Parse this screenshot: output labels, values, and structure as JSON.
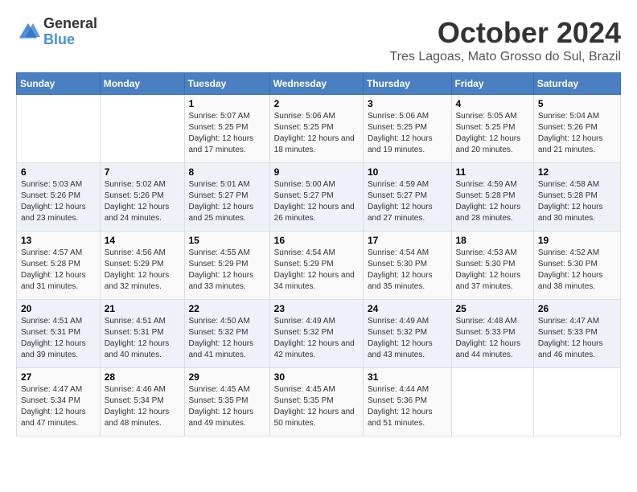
{
  "logo": {
    "general": "General",
    "blue": "Blue"
  },
  "header": {
    "month": "October 2024",
    "location": "Tres Lagoas, Mato Grosso do Sul, Brazil"
  },
  "weekdays": [
    "Sunday",
    "Monday",
    "Tuesday",
    "Wednesday",
    "Thursday",
    "Friday",
    "Saturday"
  ],
  "weeks": [
    [
      {
        "day": "",
        "sunrise": "",
        "sunset": "",
        "daylight": ""
      },
      {
        "day": "",
        "sunrise": "",
        "sunset": "",
        "daylight": ""
      },
      {
        "day": "1",
        "sunrise": "Sunrise: 5:07 AM",
        "sunset": "Sunset: 5:25 PM",
        "daylight": "Daylight: 12 hours and 17 minutes."
      },
      {
        "day": "2",
        "sunrise": "Sunrise: 5:06 AM",
        "sunset": "Sunset: 5:25 PM",
        "daylight": "Daylight: 12 hours and 18 minutes."
      },
      {
        "day": "3",
        "sunrise": "Sunrise: 5:06 AM",
        "sunset": "Sunset: 5:25 PM",
        "daylight": "Daylight: 12 hours and 19 minutes."
      },
      {
        "day": "4",
        "sunrise": "Sunrise: 5:05 AM",
        "sunset": "Sunset: 5:25 PM",
        "daylight": "Daylight: 12 hours and 20 minutes."
      },
      {
        "day": "5",
        "sunrise": "Sunrise: 5:04 AM",
        "sunset": "Sunset: 5:26 PM",
        "daylight": "Daylight: 12 hours and 21 minutes."
      }
    ],
    [
      {
        "day": "6",
        "sunrise": "Sunrise: 5:03 AM",
        "sunset": "Sunset: 5:26 PM",
        "daylight": "Daylight: 12 hours and 23 minutes."
      },
      {
        "day": "7",
        "sunrise": "Sunrise: 5:02 AM",
        "sunset": "Sunset: 5:26 PM",
        "daylight": "Daylight: 12 hours and 24 minutes."
      },
      {
        "day": "8",
        "sunrise": "Sunrise: 5:01 AM",
        "sunset": "Sunset: 5:27 PM",
        "daylight": "Daylight: 12 hours and 25 minutes."
      },
      {
        "day": "9",
        "sunrise": "Sunrise: 5:00 AM",
        "sunset": "Sunset: 5:27 PM",
        "daylight": "Daylight: 12 hours and 26 minutes."
      },
      {
        "day": "10",
        "sunrise": "Sunrise: 4:59 AM",
        "sunset": "Sunset: 5:27 PM",
        "daylight": "Daylight: 12 hours and 27 minutes."
      },
      {
        "day": "11",
        "sunrise": "Sunrise: 4:59 AM",
        "sunset": "Sunset: 5:28 PM",
        "daylight": "Daylight: 12 hours and 28 minutes."
      },
      {
        "day": "12",
        "sunrise": "Sunrise: 4:58 AM",
        "sunset": "Sunset: 5:28 PM",
        "daylight": "Daylight: 12 hours and 30 minutes."
      }
    ],
    [
      {
        "day": "13",
        "sunrise": "Sunrise: 4:57 AM",
        "sunset": "Sunset: 5:28 PM",
        "daylight": "Daylight: 12 hours and 31 minutes."
      },
      {
        "day": "14",
        "sunrise": "Sunrise: 4:56 AM",
        "sunset": "Sunset: 5:29 PM",
        "daylight": "Daylight: 12 hours and 32 minutes."
      },
      {
        "day": "15",
        "sunrise": "Sunrise: 4:55 AM",
        "sunset": "Sunset: 5:29 PM",
        "daylight": "Daylight: 12 hours and 33 minutes."
      },
      {
        "day": "16",
        "sunrise": "Sunrise: 4:54 AM",
        "sunset": "Sunset: 5:29 PM",
        "daylight": "Daylight: 12 hours and 34 minutes."
      },
      {
        "day": "17",
        "sunrise": "Sunrise: 4:54 AM",
        "sunset": "Sunset: 5:30 PM",
        "daylight": "Daylight: 12 hours and 35 minutes."
      },
      {
        "day": "18",
        "sunrise": "Sunrise: 4:53 AM",
        "sunset": "Sunset: 5:30 PM",
        "daylight": "Daylight: 12 hours and 37 minutes."
      },
      {
        "day": "19",
        "sunrise": "Sunrise: 4:52 AM",
        "sunset": "Sunset: 5:30 PM",
        "daylight": "Daylight: 12 hours and 38 minutes."
      }
    ],
    [
      {
        "day": "20",
        "sunrise": "Sunrise: 4:51 AM",
        "sunset": "Sunset: 5:31 PM",
        "daylight": "Daylight: 12 hours and 39 minutes."
      },
      {
        "day": "21",
        "sunrise": "Sunrise: 4:51 AM",
        "sunset": "Sunset: 5:31 PM",
        "daylight": "Daylight: 12 hours and 40 minutes."
      },
      {
        "day": "22",
        "sunrise": "Sunrise: 4:50 AM",
        "sunset": "Sunset: 5:32 PM",
        "daylight": "Daylight: 12 hours and 41 minutes."
      },
      {
        "day": "23",
        "sunrise": "Sunrise: 4:49 AM",
        "sunset": "Sunset: 5:32 PM",
        "daylight": "Daylight: 12 hours and 42 minutes."
      },
      {
        "day": "24",
        "sunrise": "Sunrise: 4:49 AM",
        "sunset": "Sunset: 5:32 PM",
        "daylight": "Daylight: 12 hours and 43 minutes."
      },
      {
        "day": "25",
        "sunrise": "Sunrise: 4:48 AM",
        "sunset": "Sunset: 5:33 PM",
        "daylight": "Daylight: 12 hours and 44 minutes."
      },
      {
        "day": "26",
        "sunrise": "Sunrise: 4:47 AM",
        "sunset": "Sunset: 5:33 PM",
        "daylight": "Daylight: 12 hours and 46 minutes."
      }
    ],
    [
      {
        "day": "27",
        "sunrise": "Sunrise: 4:47 AM",
        "sunset": "Sunset: 5:34 PM",
        "daylight": "Daylight: 12 hours and 47 minutes."
      },
      {
        "day": "28",
        "sunrise": "Sunrise: 4:46 AM",
        "sunset": "Sunset: 5:34 PM",
        "daylight": "Daylight: 12 hours and 48 minutes."
      },
      {
        "day": "29",
        "sunrise": "Sunrise: 4:45 AM",
        "sunset": "Sunset: 5:35 PM",
        "daylight": "Daylight: 12 hours and 49 minutes."
      },
      {
        "day": "30",
        "sunrise": "Sunrise: 4:45 AM",
        "sunset": "Sunset: 5:35 PM",
        "daylight": "Daylight: 12 hours and 50 minutes."
      },
      {
        "day": "31",
        "sunrise": "Sunrise: 4:44 AM",
        "sunset": "Sunset: 5:36 PM",
        "daylight": "Daylight: 12 hours and 51 minutes."
      },
      {
        "day": "",
        "sunrise": "",
        "sunset": "",
        "daylight": ""
      },
      {
        "day": "",
        "sunrise": "",
        "sunset": "",
        "daylight": ""
      }
    ]
  ]
}
